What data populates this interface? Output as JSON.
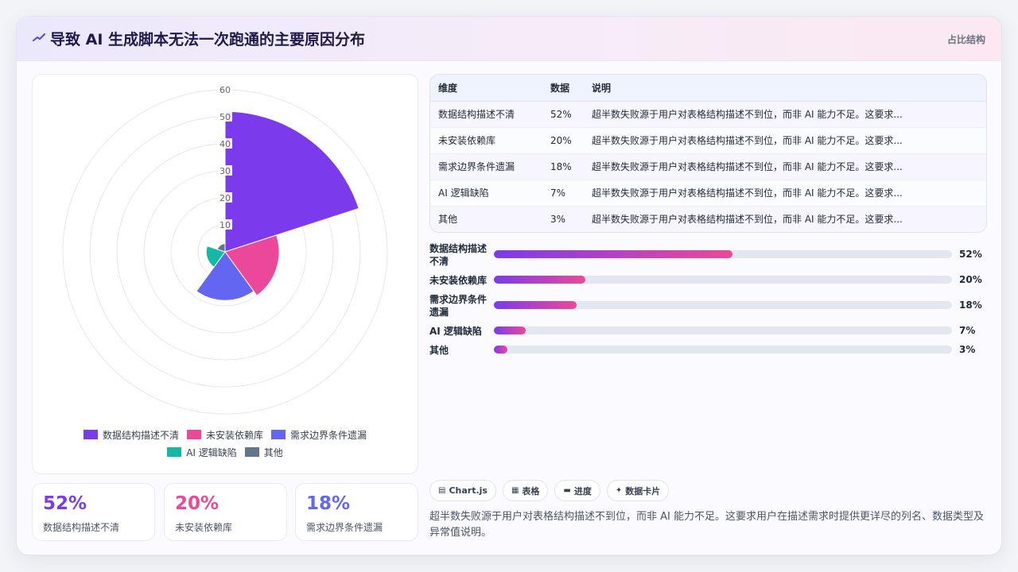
{
  "header": {
    "title": "导致 AI 生成脚本无法一次跑通的主要原因分布",
    "tag": "占比结构",
    "accent": "#4f46e5"
  },
  "chart_data": {
    "type": "polarArea",
    "categories": [
      "数据结构描述不清",
      "未安装依赖库",
      "需求边界条件遗漏",
      "AI 逻辑缺陷",
      "其他"
    ],
    "values": [
      52,
      20,
      18,
      7,
      3
    ],
    "colors": [
      "#7c3aed",
      "#ec4899",
      "#6366f1",
      "#14b8a6",
      "#64748b"
    ],
    "r_ticks": [
      10,
      20,
      30,
      40,
      50,
      60
    ],
    "r_max": 60,
    "legend_position": "bottom",
    "title": ""
  },
  "stats": [
    {
      "value": "52%",
      "label": "数据结构描述不清",
      "color": "#7c3aed"
    },
    {
      "value": "20%",
      "label": "未安装依赖库",
      "color": "#ec4899"
    },
    {
      "value": "18%",
      "label": "需求边界条件遗漏",
      "color": "#6366f1"
    }
  ],
  "table": {
    "headers": [
      "维度",
      "数据",
      "说明"
    ],
    "rows": [
      [
        "数据结构描述不清",
        "52%",
        "超半数失败源于用户对表格结构描述不到位，而非 AI 能力不足。这要求..."
      ],
      [
        "未安装依赖库",
        "20%",
        "超半数失败源于用户对表格结构描述不到位，而非 AI 能力不足。这要求..."
      ],
      [
        "需求边界条件遗漏",
        "18%",
        "超半数失败源于用户对表格结构描述不到位，而非 AI 能力不足。这要求..."
      ],
      [
        "AI 逻辑缺陷",
        "7%",
        "超半数失败源于用户对表格结构描述不到位，而非 AI 能力不足。这要求..."
      ],
      [
        "其他",
        "3%",
        "超半数失败源于用户对表格结构描述不到位，而非 AI 能力不足。这要求..."
      ]
    ]
  },
  "progress": [
    {
      "label": "数据结构描述不清",
      "value": 52,
      "text": "52%"
    },
    {
      "label": "未安装依赖库",
      "value": 20,
      "text": "20%"
    },
    {
      "label": "需求边界条件遗漏",
      "value": 18,
      "text": "18%"
    },
    {
      "label": "AI 逻辑缺陷",
      "value": 7,
      "text": "7%"
    },
    {
      "label": "其他",
      "value": 3,
      "text": "3%"
    }
  ],
  "pills": [
    {
      "icon": "chart-icon",
      "glyph": "▤",
      "label": "Chart.js"
    },
    {
      "icon": "table-icon",
      "glyph": "▦",
      "label": "表格"
    },
    {
      "icon": "progress-icon",
      "glyph": "▬",
      "label": "进度"
    },
    {
      "icon": "sparkle-icon",
      "glyph": "✦",
      "label": "数据卡片"
    }
  ],
  "description": "超半数失败源于用户对表格结构描述不到位，而非 AI 能力不足。这要求用户在描述需求时提供更详尽的列名、数据类型及异常值说明。"
}
